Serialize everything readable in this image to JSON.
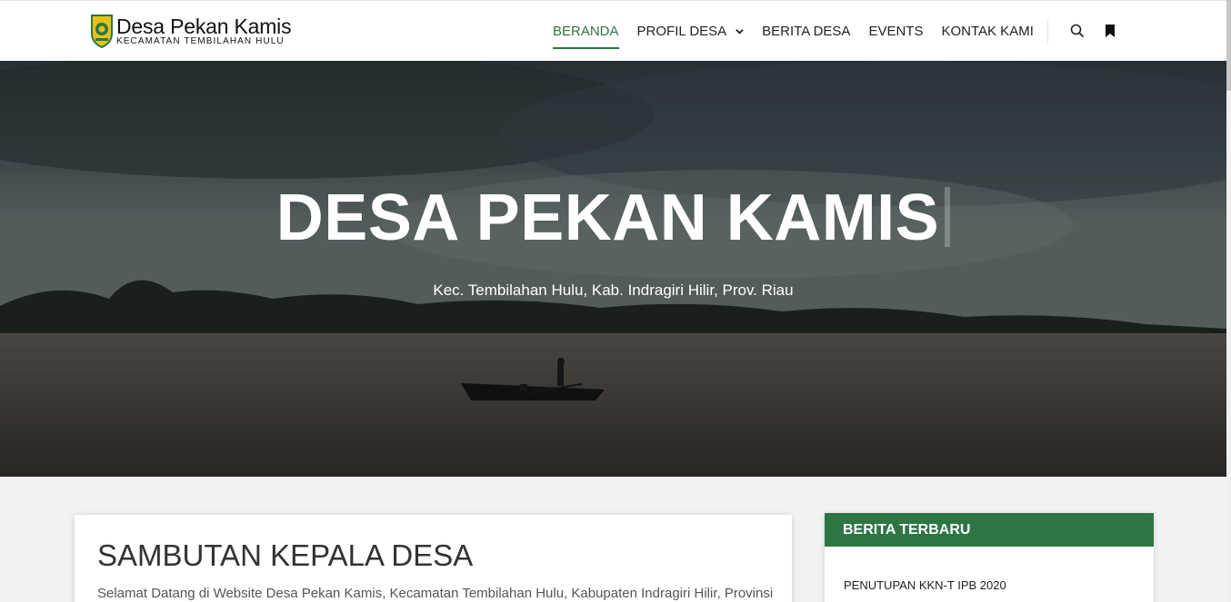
{
  "brand": {
    "title": "Desa Pekan Kamis",
    "subtitle": "KECAMATAN TEMBILAHAN HULU"
  },
  "nav": {
    "items": [
      {
        "label": "BERANDA",
        "active": true
      },
      {
        "label": "PROFIL DESA",
        "dropdown": true
      },
      {
        "label": "BERITA DESA"
      },
      {
        "label": "EVENTS"
      },
      {
        "label": "KONTAK KAMI"
      }
    ],
    "icons": [
      "search-icon",
      "bookmark-icon"
    ]
  },
  "hero": {
    "title": "DESA PEKAN KAMIS",
    "subtitle": "Kec. Tembilahan Hulu, Kab. Indragiri Hilir, Prov. Riau"
  },
  "welcome": {
    "title": "SAMBUTAN KEPALA DESA",
    "text": "Selamat Datang di Website Desa Pekan Kamis, Kecamatan Tembilahan Hulu, Kabupaten Indragiri Hilir, Provinsi"
  },
  "sidebar": {
    "heading": "BERITA TERBARU",
    "items": [
      "PENUTUPAN KKN-T IPB 2020"
    ]
  },
  "colors": {
    "accent": "#2e7544"
  }
}
